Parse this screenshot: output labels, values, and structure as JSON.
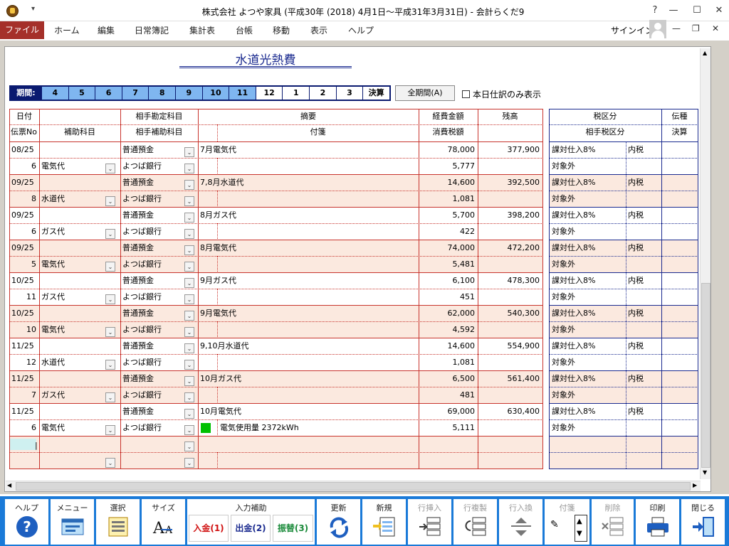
{
  "titlebar": {
    "title": "株式会社 よつや家具 (平成30年 (2018) 4月1日～平成31年3月31日) - 会計らくだ9",
    "help": "?"
  },
  "menu": {
    "items": [
      "ファイル",
      "ホーム",
      "編集",
      "日常簿記",
      "集計表",
      "台帳",
      "移動",
      "表示",
      "ヘルプ"
    ],
    "signin": "サインイン"
  },
  "page": {
    "title": "水道光熱費"
  },
  "period": {
    "label": "期間:",
    "months": [
      "4",
      "5",
      "6",
      "7",
      "8",
      "9",
      "10",
      "11",
      "12",
      "1",
      "2",
      "3",
      "決算"
    ],
    "all_button": "全期間(A)",
    "today_only": "本日仕訳のみ表示"
  },
  "headers": {
    "date": "日付",
    "voucher_no": "伝票No",
    "sub_account": "補助科目",
    "counter_account": "相手勘定科目",
    "counter_sub": "相手補助科目",
    "summary": "摘要",
    "note": "付箋",
    "amount": "経費金額",
    "tax": "消費税額",
    "balance": "残高",
    "tax_class": "税区分",
    "counter_tax": "相手税区分",
    "slip_type": "伝種",
    "settle": "決算"
  },
  "rows": [
    {
      "date": "08/25",
      "no": "6",
      "sub": "電気代",
      "acc": "普通預金",
      "accsub": "よつば銀行",
      "summary": "7月電気代",
      "note": "",
      "amount": "78,000",
      "tax": "5,777",
      "balance": "377,900",
      "taxclass": "課対仕入8%",
      "incl": "内税",
      "ctax": "対象外"
    },
    {
      "date": "09/25",
      "no": "8",
      "sub": "水道代",
      "acc": "普通預金",
      "accsub": "よつば銀行",
      "summary": "7,8月水道代",
      "note": "",
      "amount": "14,600",
      "tax": "1,081",
      "balance": "392,500",
      "taxclass": "課対仕入8%",
      "incl": "内税",
      "ctax": "対象外"
    },
    {
      "date": "09/25",
      "no": "6",
      "sub": "ガス代",
      "acc": "普通預金",
      "accsub": "よつば銀行",
      "summary": "8月ガス代",
      "note": "",
      "amount": "5,700",
      "tax": "422",
      "balance": "398,200",
      "taxclass": "課対仕入8%",
      "incl": "内税",
      "ctax": "対象外"
    },
    {
      "date": "09/25",
      "no": "5",
      "sub": "電気代",
      "acc": "普通預金",
      "accsub": "よつば銀行",
      "summary": "8月電気代",
      "note": "",
      "amount": "74,000",
      "tax": "5,481",
      "balance": "472,200",
      "taxclass": "課対仕入8%",
      "incl": "内税",
      "ctax": "対象外"
    },
    {
      "date": "10/25",
      "no": "11",
      "sub": "ガス代",
      "acc": "普通預金",
      "accsub": "よつば銀行",
      "summary": "9月ガス代",
      "note": "",
      "amount": "6,100",
      "tax": "451",
      "balance": "478,300",
      "taxclass": "課対仕入8%",
      "incl": "内税",
      "ctax": "対象外"
    },
    {
      "date": "10/25",
      "no": "10",
      "sub": "電気代",
      "acc": "普通預金",
      "accsub": "よつば銀行",
      "summary": "9月電気代",
      "note": "",
      "amount": "62,000",
      "tax": "4,592",
      "balance": "540,300",
      "taxclass": "課対仕入8%",
      "incl": "内税",
      "ctax": "対象外"
    },
    {
      "date": "11/25",
      "no": "12",
      "sub": "水道代",
      "acc": "普通預金",
      "accsub": "よつば銀行",
      "summary": "9,10月水道代",
      "note": "",
      "amount": "14,600",
      "tax": "1,081",
      "balance": "554,900",
      "taxclass": "課対仕入8%",
      "incl": "内税",
      "ctax": "対象外"
    },
    {
      "date": "11/25",
      "no": "7",
      "sub": "ガス代",
      "acc": "普通預金",
      "accsub": "よつば銀行",
      "summary": "10月ガス代",
      "note": "",
      "amount": "6,500",
      "tax": "481",
      "balance": "561,400",
      "taxclass": "課対仕入8%",
      "incl": "内税",
      "ctax": "対象外"
    },
    {
      "date": "11/25",
      "no": "6",
      "sub": "電気代",
      "acc": "普通預金",
      "accsub": "よつば銀行",
      "summary": "10月電気代",
      "note": "電気使用量 2372kWh",
      "amount": "69,000",
      "tax": "5,111",
      "balance": "630,400",
      "taxclass": "課対仕入8%",
      "incl": "内税",
      "ctax": "対象外"
    }
  ],
  "toolbar": {
    "help": "ヘルプ",
    "menu": "メニュー",
    "select": "選択",
    "size": "サイズ",
    "input_assist": "入力補助",
    "nyukin": "入金(1)",
    "shukkin": "出金(2)",
    "furikae": "振替(3)",
    "refresh": "更新",
    "new": "新規",
    "insert": "行挿入",
    "copy": "行複製",
    "swap": "行入換",
    "fusen": "付箋",
    "delete": "削除",
    "print": "印刷",
    "close": "閉じる"
  },
  "colors": {
    "accent": "#a5302a",
    "row_alt": "#fbe9df",
    "grid": "#c8342d",
    "navy": "#1a2a8f",
    "toolbar": "#1a7ad8",
    "period_active": "#7fb6f0",
    "note_mark": "#00c000"
  }
}
